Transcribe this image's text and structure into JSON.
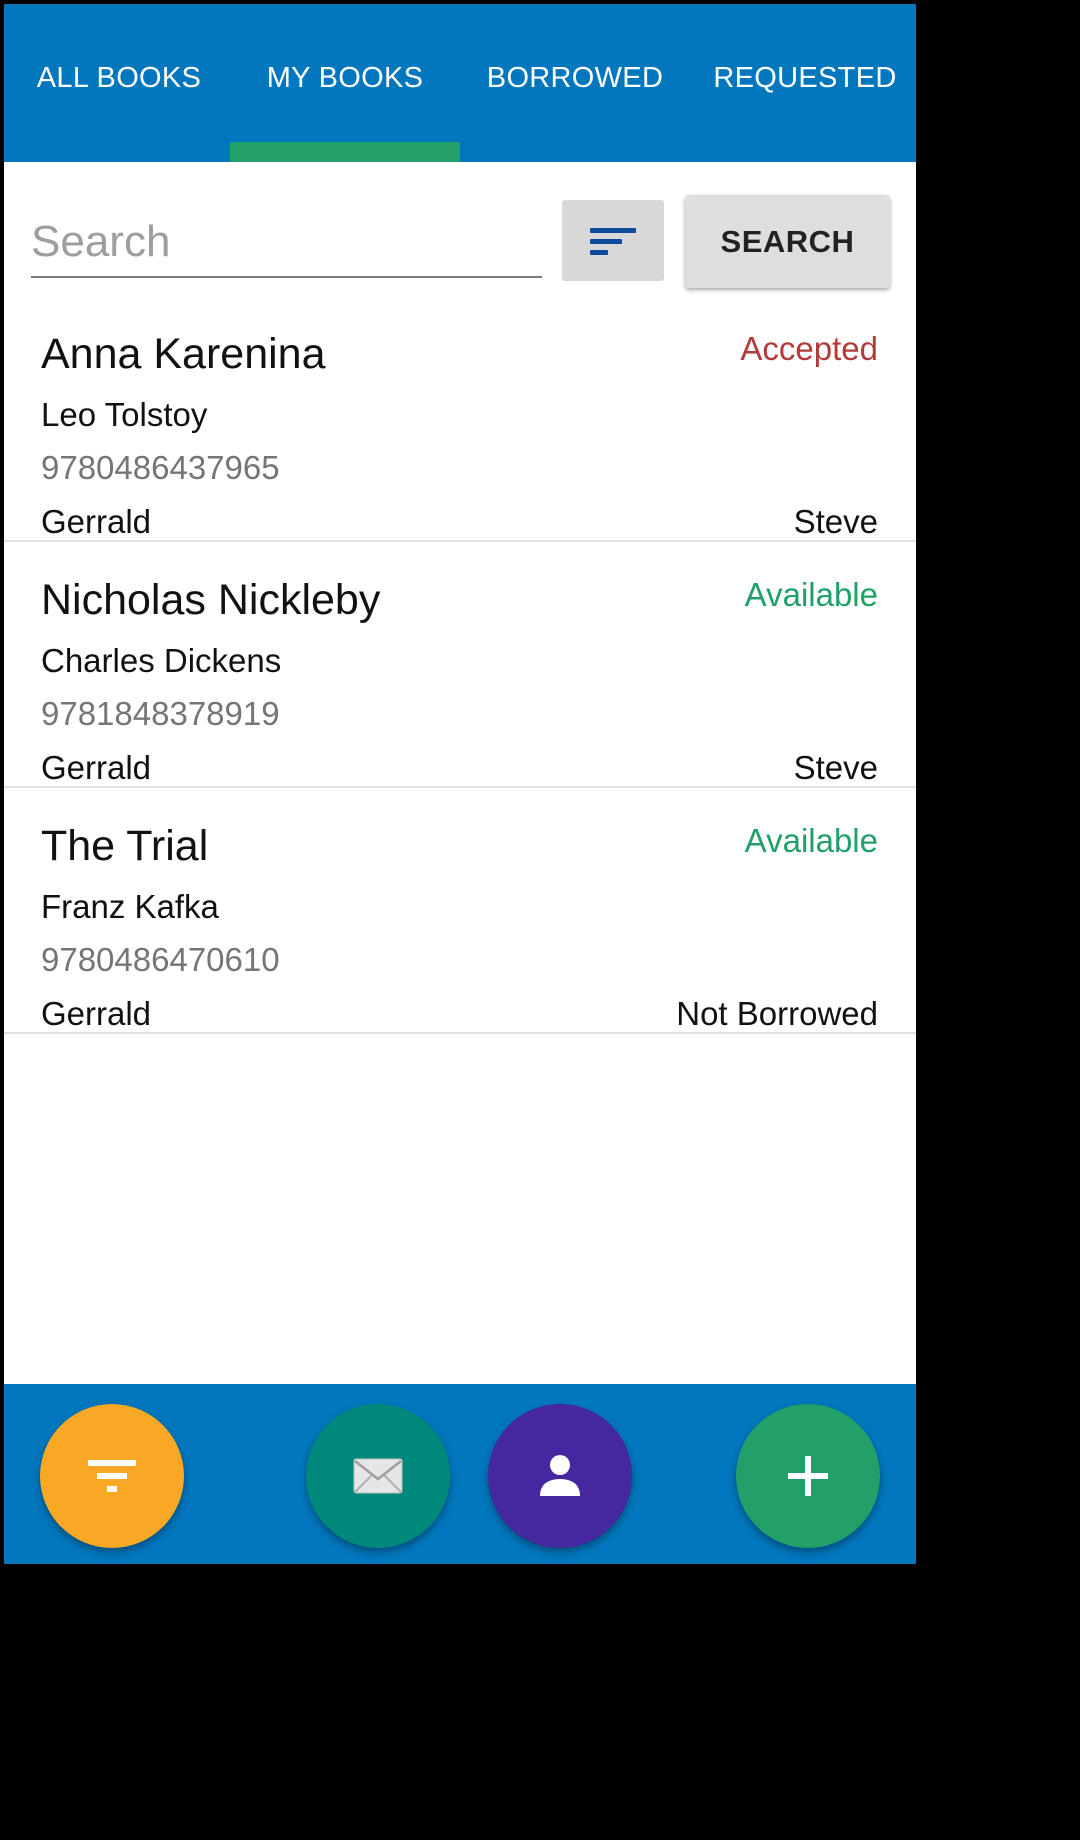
{
  "tabs": [
    {
      "label": "ALL BOOKS",
      "active": false
    },
    {
      "label": "MY BOOKS",
      "active": true
    },
    {
      "label": "BORROWED",
      "active": false
    },
    {
      "label": "REQUESTED",
      "active": false
    }
  ],
  "search": {
    "placeholder": "Search",
    "value": "",
    "sort_icon": "sort-lines-icon",
    "button_label": "SEARCH"
  },
  "books": [
    {
      "title": "Anna Karenina",
      "author": "Leo Tolstoy",
      "isbn": "9780486437965",
      "owner": "Gerrald",
      "status": "Accepted",
      "status_color": "#b23a3a",
      "borrower": "Steve"
    },
    {
      "title": "Nicholas Nickleby",
      "author": "Charles Dickens",
      "isbn": "9781848378919",
      "owner": "Gerrald",
      "status": "Available",
      "status_color": "#21a06a",
      "borrower": "Steve"
    },
    {
      "title": "The Trial",
      "author": "Franz Kafka",
      "isbn": "9780486470610",
      "owner": "Gerrald",
      "status": "Available",
      "status_color": "#21a06a",
      "borrower": "Not Borrowed"
    }
  ],
  "colors": {
    "primary": "#0277bd",
    "tab_indicator": "#21a06a",
    "fab_filter": "#f9a825",
    "fab_mail": "#00897b",
    "fab_profile": "#4527a0",
    "fab_add": "#21a06a"
  },
  "bottom_actions": [
    {
      "icon": "filter-icon",
      "color": "#f9a825"
    },
    {
      "icon": "mail-icon",
      "color": "#00897b"
    },
    {
      "icon": "person-icon",
      "color": "#4527a0"
    },
    {
      "icon": "plus-icon",
      "color": "#21a06a"
    }
  ]
}
